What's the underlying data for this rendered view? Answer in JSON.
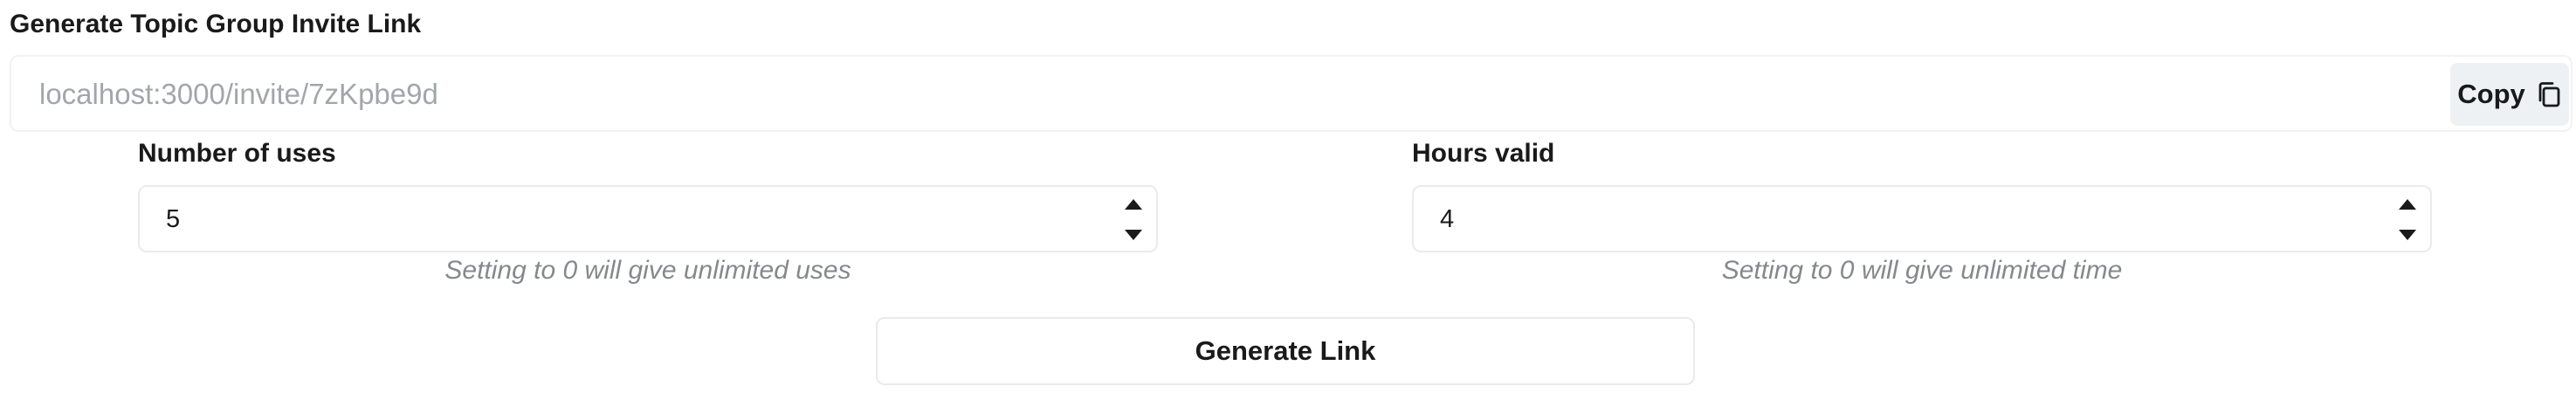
{
  "header": {
    "title": "Generate Topic Group Invite Link"
  },
  "invite": {
    "link": "localhost:3000/invite/7zKpbe9d",
    "copy_label": "Copy",
    "copy_icon": "copy-icon"
  },
  "uses": {
    "label": "Number of uses",
    "value": "5",
    "hint": "Setting to 0 will give unlimited uses"
  },
  "hours": {
    "label": "Hours valid",
    "value": "4",
    "hint": "Setting to 0 will give unlimited time"
  },
  "actions": {
    "generate_label": "Generate Link"
  }
}
